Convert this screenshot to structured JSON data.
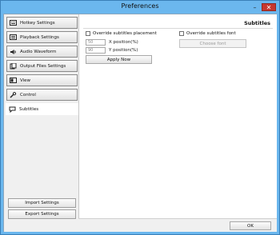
{
  "window": {
    "title": "Preferences",
    "minimize_glyph": "–",
    "close_glyph": "✕"
  },
  "sidebar": {
    "items": [
      {
        "label": "Hotkey Settings",
        "icon": "keyboard-icon"
      },
      {
        "label": "Playback Settings",
        "icon": "playback-icon"
      },
      {
        "label": "Audio Waveform",
        "icon": "speaker-icon"
      },
      {
        "label": "Output Files Settings",
        "icon": "output-files-icon"
      },
      {
        "label": "View",
        "icon": "view-icon"
      },
      {
        "label": "Control",
        "icon": "wrench-icon"
      },
      {
        "label": "Subtitles",
        "icon": "subtitle-bubble-icon",
        "active": true
      }
    ],
    "import_label": "Import Settings",
    "export_label": "Export Settings"
  },
  "panel": {
    "title": "Subtitles",
    "override_placement_label": "Override subtitles placement",
    "override_placement_checked": false,
    "x_position": {
      "value": "50",
      "label": "X position(%)"
    },
    "y_position": {
      "value": "90",
      "label": "Y position(%)"
    },
    "apply_label": "Apply Now",
    "override_font_label": "Override subtitles font",
    "override_font_checked": false,
    "choose_font_label": "Choose font"
  },
  "footer": {
    "ok_label": "OK"
  }
}
